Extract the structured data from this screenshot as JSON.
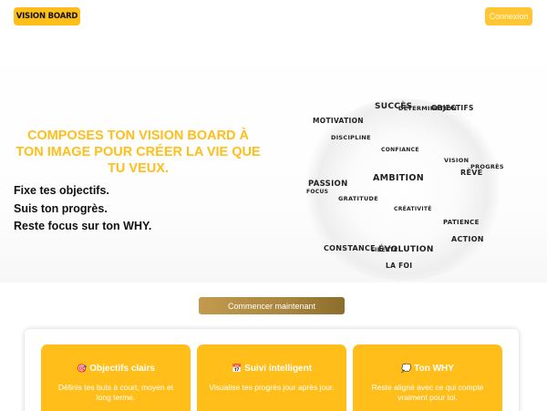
{
  "header": {
    "logo": "VISION BOARD",
    "login_label": "Connexion"
  },
  "hero": {
    "headline": "COMPOSES TON VISION BOARD À TON IMAGE POUR CRÉER LA VIE QUE TU VEUX.",
    "taglines": [
      "Fixe tes objectifs.",
      "Suis ton progrès.",
      "Reste focus sur ton WHY."
    ]
  },
  "word_cloud": {
    "succes": "SUCCÈS",
    "determination": "DÉTERMINATION",
    "objectifs": "OBJECTIFS",
    "motivation": "MOTIVATION",
    "discipline": "DISCIPLINE",
    "confiance": "CONFIANCE",
    "vision": "VISION",
    "progres": "PROGRÈS",
    "reve": "RÊVE",
    "passion": "PASSION",
    "ambition": "AMBITION",
    "focus": "FOCUS",
    "gratitude": "GRATITUDE",
    "creativite": "CRÉATIVITÉ",
    "patience": "PATIENCE",
    "action": "ACTION",
    "constance": "CONSTANCE",
    "liberte": "LIBERTÉ",
    "evolution": "ÉVOLUTION",
    "la_foi": "LA FOI"
  },
  "cta_label": "Commencer maintenant",
  "features": [
    {
      "icon": "target-icon",
      "glyph": "🎯",
      "title": "Objectifs clairs",
      "text": "Définis tes buts à court, moyen et long terme."
    },
    {
      "icon": "calendar-icon",
      "glyph": "📅",
      "title": "Suivi intelligent",
      "text": "Visualise tes progrès jour après jour."
    },
    {
      "icon": "speech-bubble-icon",
      "glyph": "💭",
      "title": "Ton WHY",
      "text": "Reste aligné avec ce qui compte vraiment pour toi."
    }
  ],
  "colors": {
    "accent": "#ffbe1a",
    "cta_gradient_start": "#c19a4d",
    "cta_gradient_end": "#8c6d2c"
  }
}
